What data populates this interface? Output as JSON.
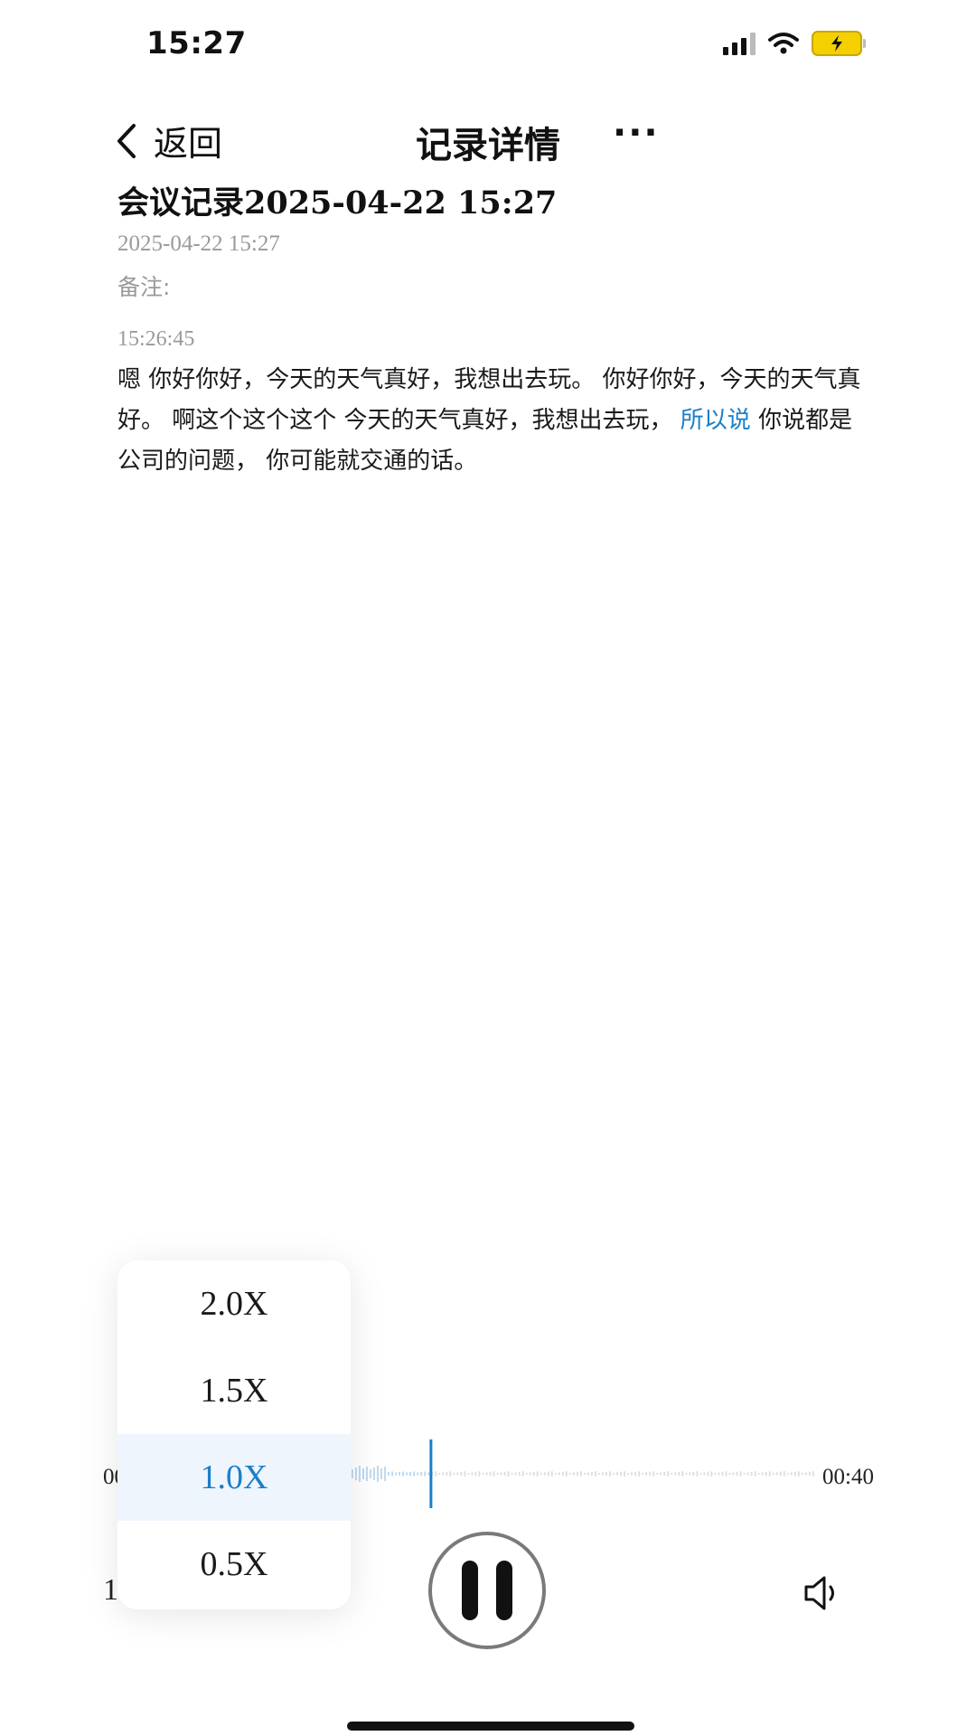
{
  "status_bar": {
    "time": "15:27"
  },
  "nav": {
    "back_label": "返回",
    "title": "记录详情",
    "more_label": "···"
  },
  "record": {
    "title": "会议记录2025-04-22 15:27",
    "date": "2025-04-22 15:27",
    "note_label": "备注:"
  },
  "segment": {
    "timestamp": "15:26:45",
    "text_before": "嗯 你好你好，今天的天气真好，我想出去玩。 你好你好，今天的天气真好。 啊这个这个这个 今天的天气真好，我想出去玩， ",
    "text_highlight": "所以说",
    "text_after": " 你说都是公司的问题， 你可能就交通的话。"
  },
  "player": {
    "time_start": "00:00",
    "time_end": "00:40",
    "speed_label": "1.0X",
    "progress": 0.17
  },
  "speed_menu": {
    "options": [
      "2.0X",
      "1.5X",
      "1.0X",
      "0.5X"
    ],
    "selected": "1.0X"
  },
  "colors": {
    "accent": "#1a7fc9",
    "battery": "#f4d000"
  }
}
